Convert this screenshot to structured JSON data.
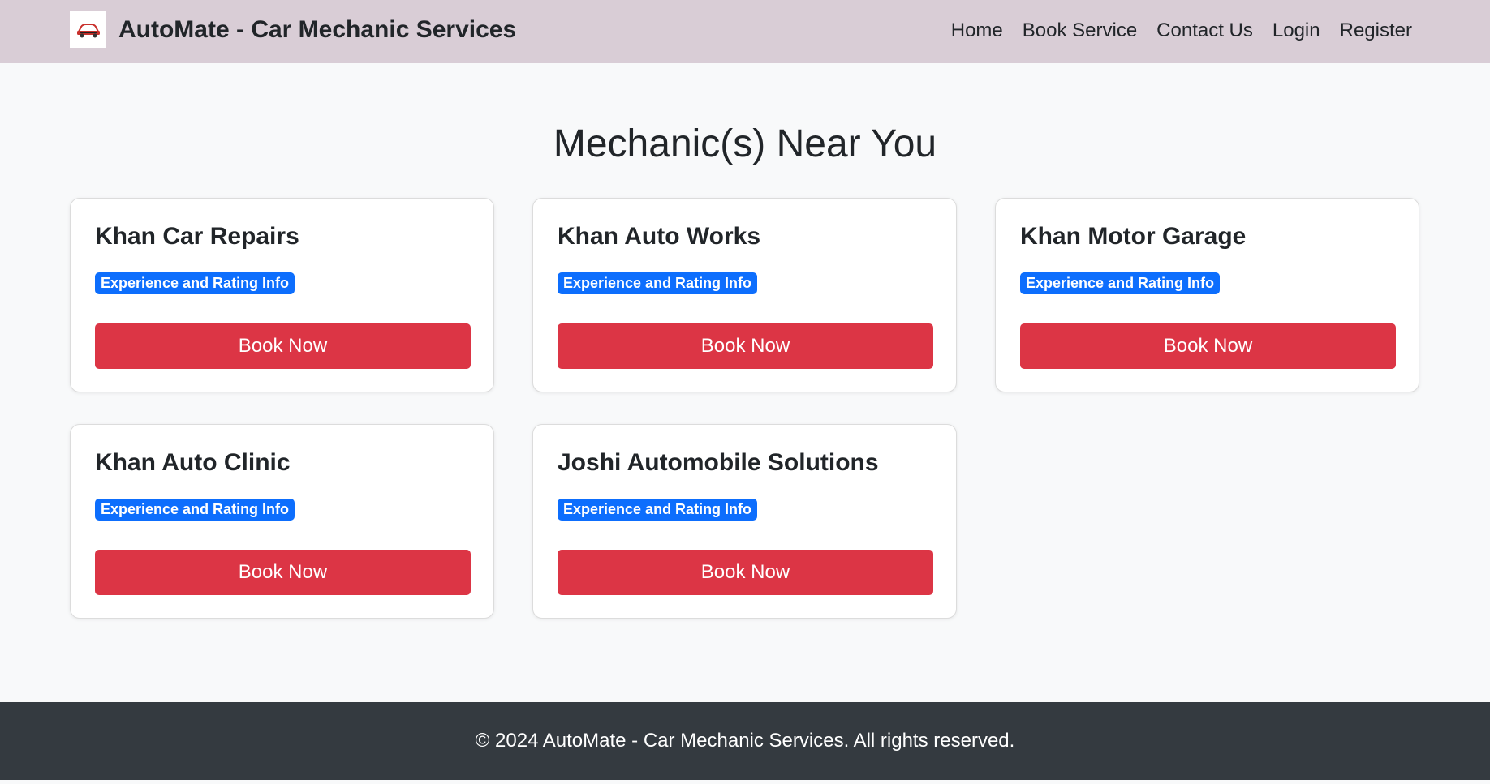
{
  "header": {
    "brand_name": "AutoMate - Car Mechanic Services",
    "logo_icon": "car-logo-icon",
    "nav": [
      {
        "label": "Home"
      },
      {
        "label": "Book Service"
      },
      {
        "label": "Contact Us"
      },
      {
        "label": "Login"
      },
      {
        "label": "Register"
      }
    ]
  },
  "main": {
    "title": "Mechanic(s) Near You",
    "cards": [
      {
        "name": "Khan Car Repairs",
        "badge": "Experience and Rating Info",
        "button": "Book Now"
      },
      {
        "name": "Khan Auto Works",
        "badge": "Experience and Rating Info",
        "button": "Book Now"
      },
      {
        "name": "Khan Motor Garage",
        "badge": "Experience and Rating Info",
        "button": "Book Now"
      },
      {
        "name": "Khan Auto Clinic",
        "badge": "Experience and Rating Info",
        "button": "Book Now"
      },
      {
        "name": "Joshi Automobile Solutions",
        "badge": "Experience and Rating Info",
        "button": "Book Now"
      }
    ]
  },
  "footer": {
    "text": "© 2024 AutoMate - Car Mechanic Services. All rights reserved."
  },
  "colors": {
    "navbar_bg": "#d9cdd6",
    "page_bg": "#f8f9fa",
    "badge_bg": "#0d6efd",
    "button_bg": "#dc3545",
    "footer_bg": "#343a40"
  }
}
